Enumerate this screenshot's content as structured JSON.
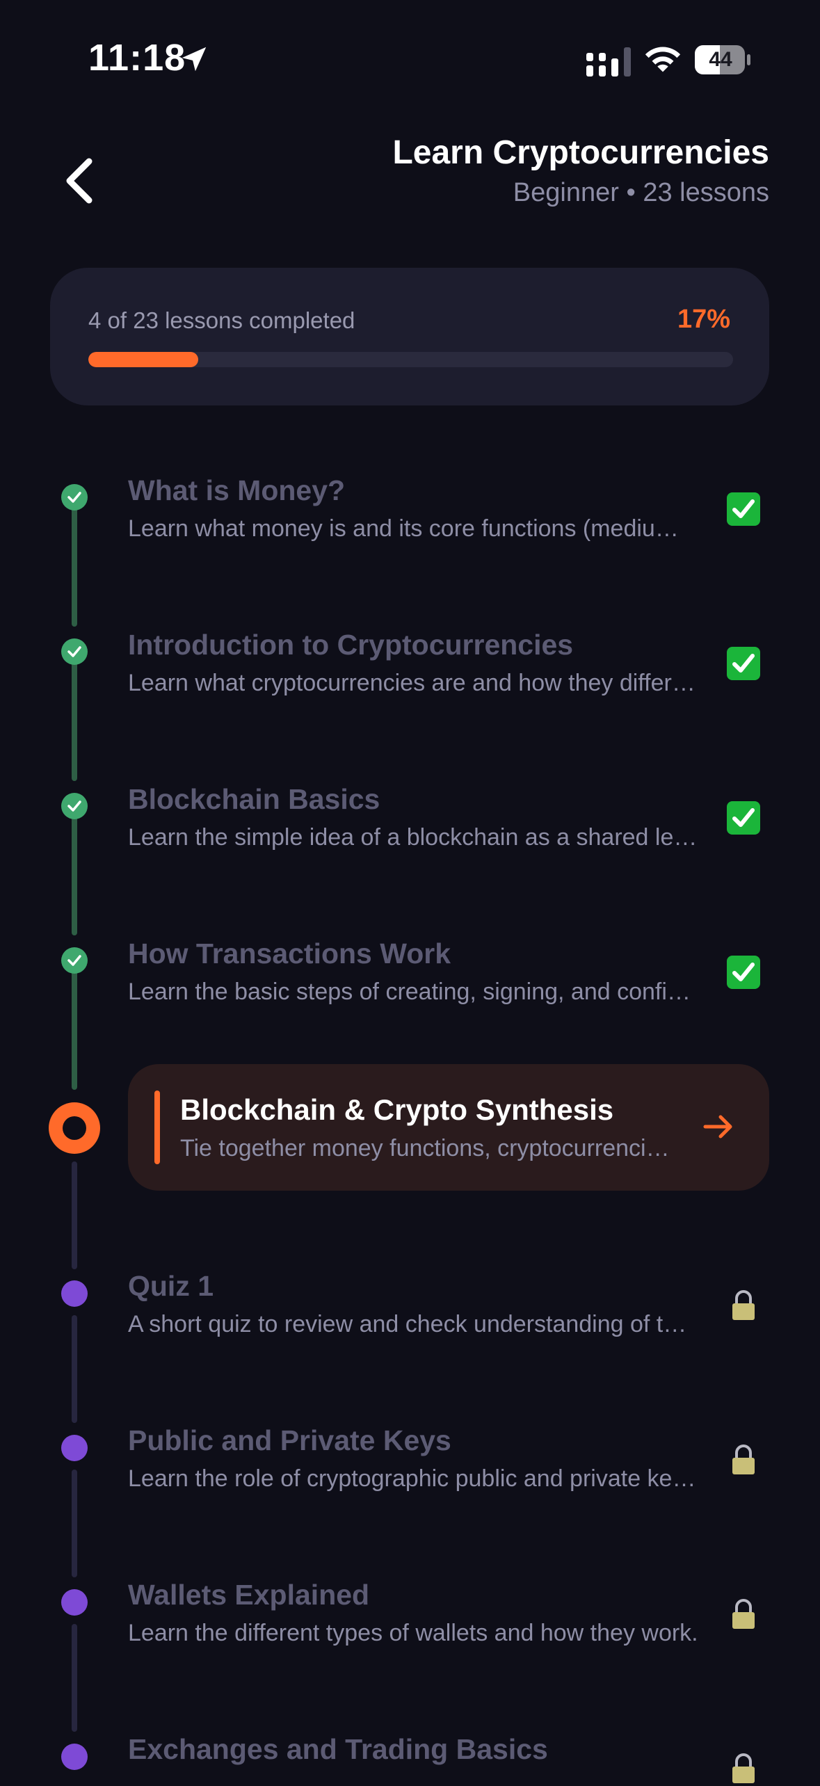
{
  "status_bar": {
    "time": "11:18",
    "battery": "44"
  },
  "header": {
    "back_icon": "chevron-left-icon",
    "title": "Learn Cryptocurrencies",
    "subtitle": "Beginner • 23 lessons"
  },
  "progress": {
    "label": "4 of 23 lessons completed",
    "percent_text": "17%",
    "fraction": 0.17,
    "accent": "#ff6a2a"
  },
  "lessons": [
    {
      "title": "What is Money?",
      "desc": "Learn what money is and its core functions (medium of exchange, unit of account, store of value).",
      "status": "completed",
      "icon": "check-mark-button-icon"
    },
    {
      "title": "Introduction to Cryptocurrencies",
      "desc": "Learn what cryptocurrencies are and how they differ from traditional money.",
      "status": "completed",
      "icon": "check-mark-button-icon"
    },
    {
      "title": "Blockchain Basics",
      "desc": "Learn the simple idea of a blockchain as a shared ledger.",
      "status": "completed",
      "icon": "check-mark-button-icon"
    },
    {
      "title": "How Transactions Work",
      "desc": "Learn the basic steps of creating, signing, and confirming a transaction.",
      "status": "completed",
      "icon": "check-mark-button-icon"
    },
    {
      "title": "Blockchain & Crypto Synthesis",
      "desc": "Tie together money functions, cryptocurrencies and blockchain.",
      "status": "current",
      "icon": "arrow-right-icon"
    },
    {
      "title": "Quiz 1",
      "desc": "A short quiz to review and check understanding of the first lessons.",
      "status": "locked",
      "icon": "lock-icon"
    },
    {
      "title": "Public and Private Keys",
      "desc": "Learn the role of cryptographic public and private keys.",
      "status": "locked",
      "icon": "lock-icon"
    },
    {
      "title": "Wallets Explained",
      "desc": "Learn the different types of wallets and how they work.",
      "status": "locked",
      "icon": "lock-icon"
    },
    {
      "title": "Exchanges and Trading Basics",
      "desc": "",
      "status": "locked",
      "icon": "lock-icon"
    }
  ],
  "colors": {
    "background": "#0e0e18",
    "completed": "#3fa86e",
    "locked": "#7e4ad6",
    "current": "#ff6a2a"
  }
}
